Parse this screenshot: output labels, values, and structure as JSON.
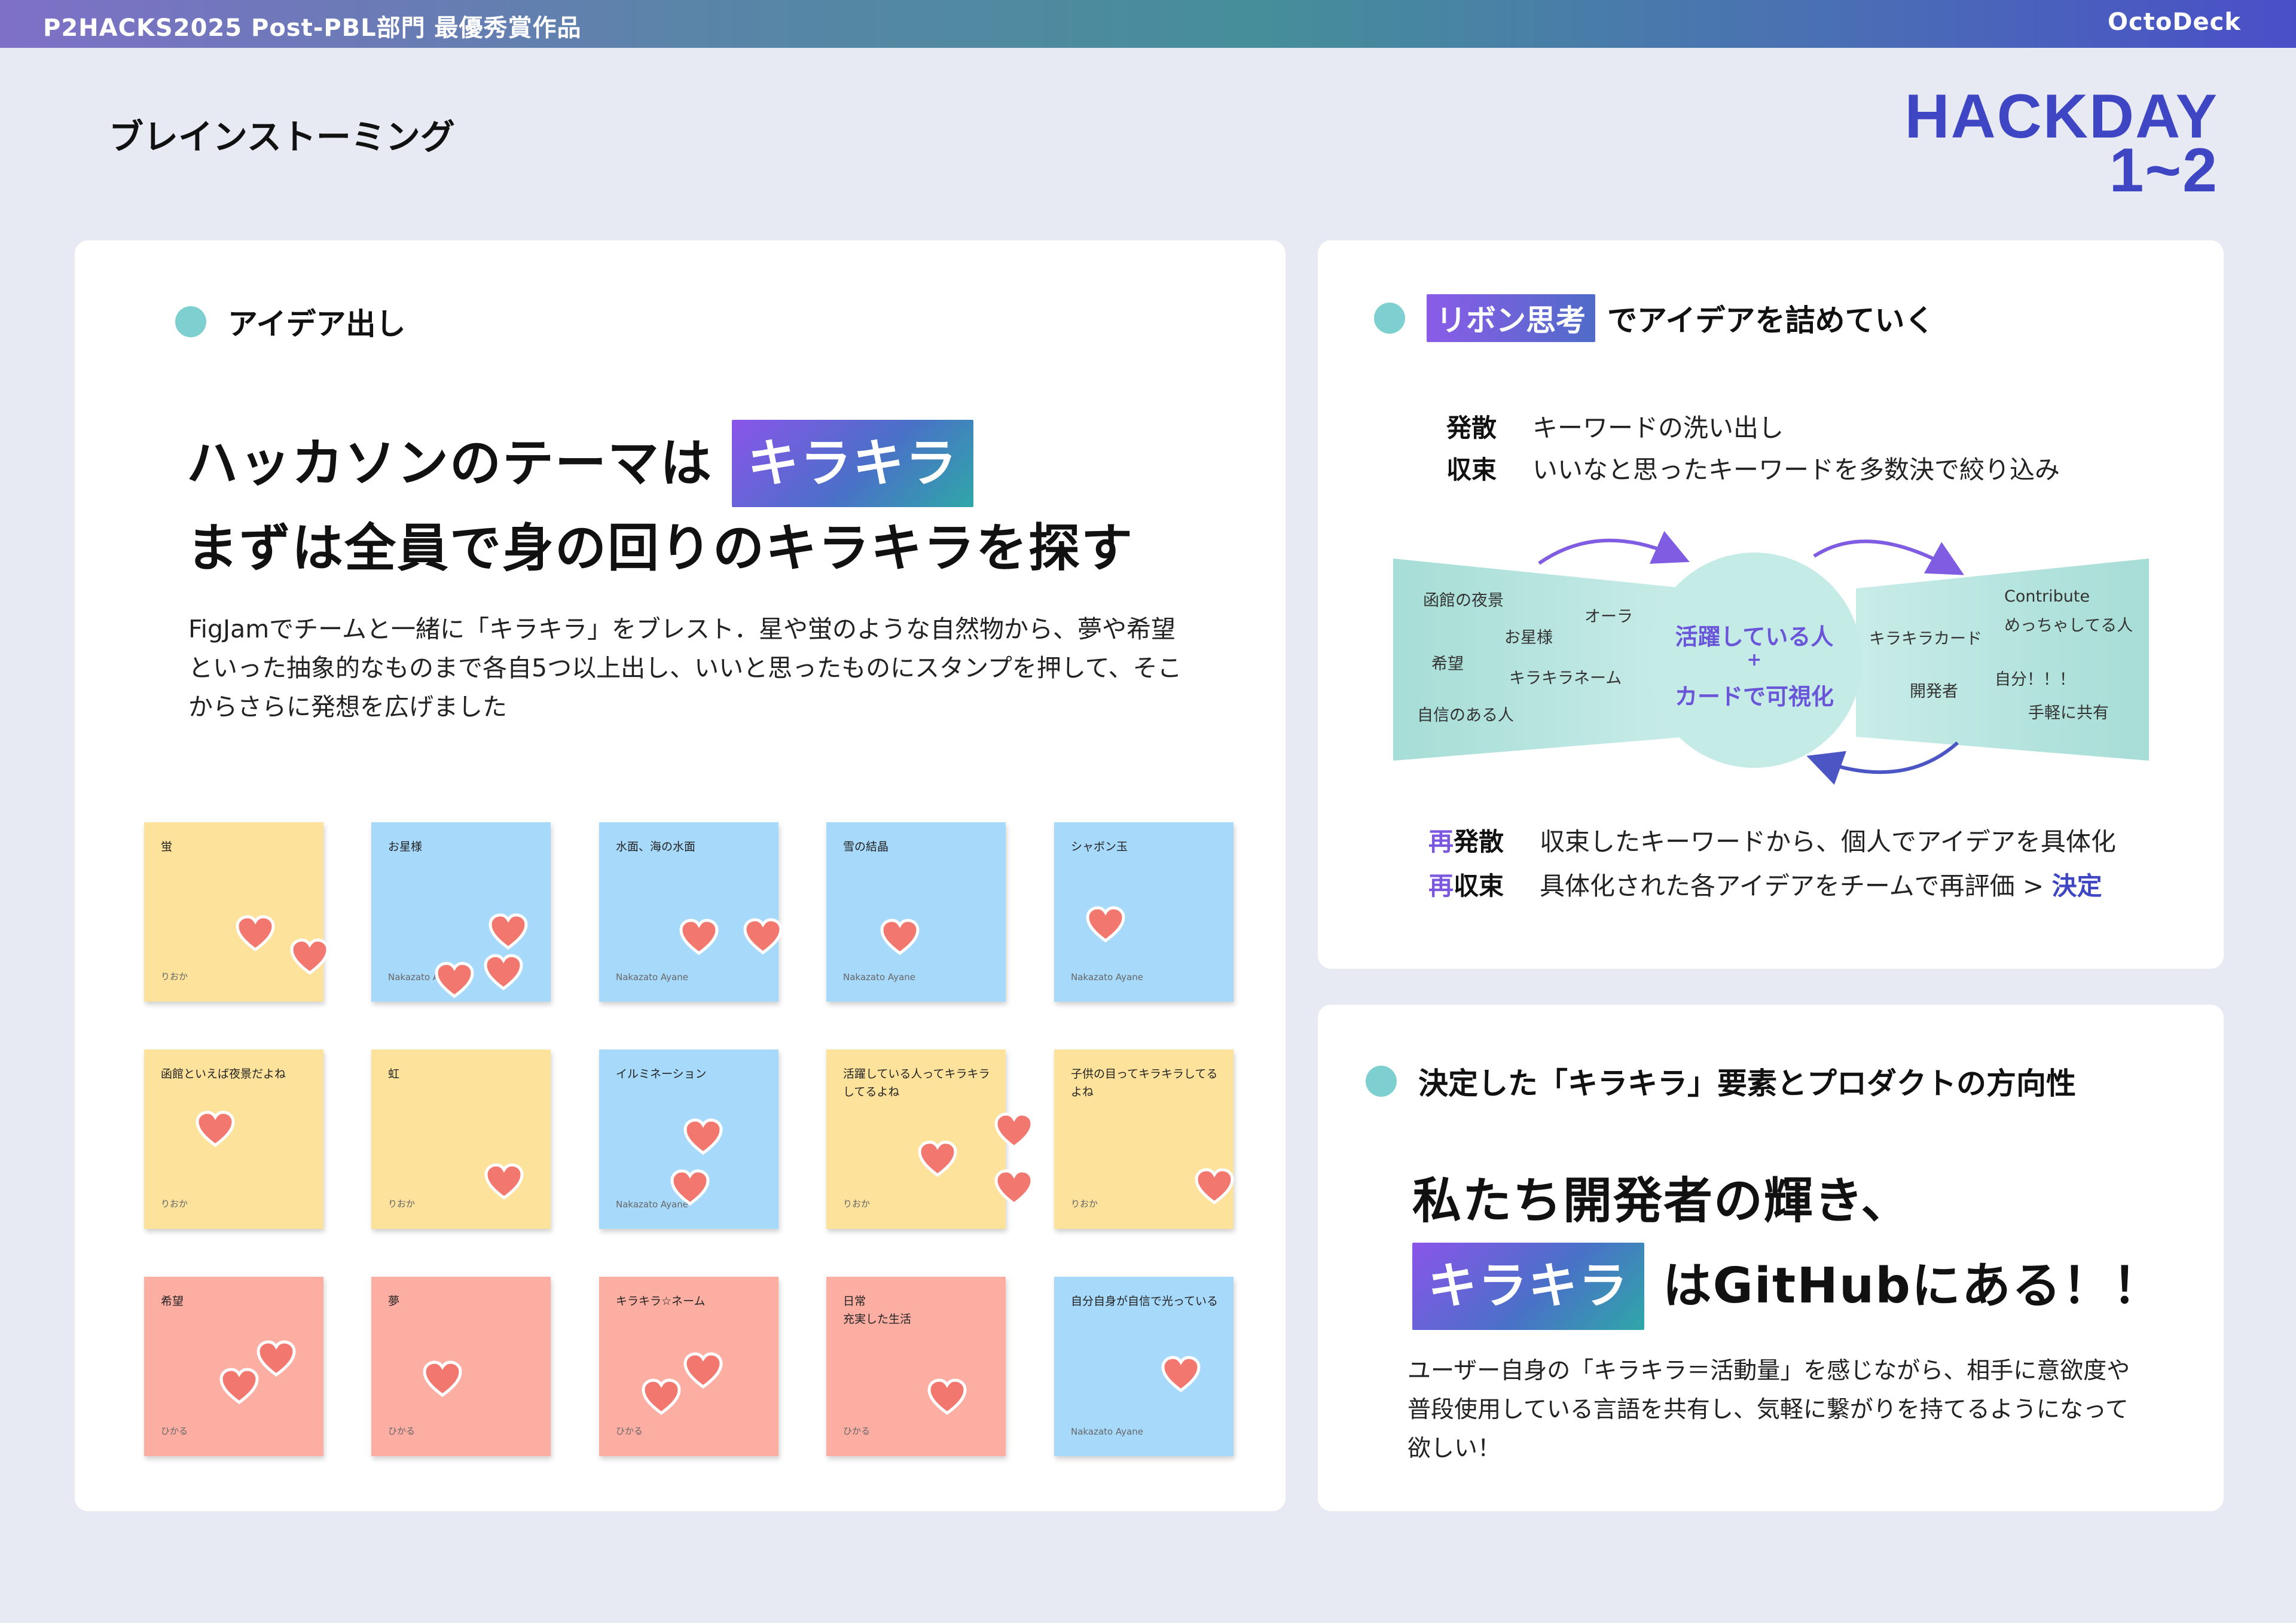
{
  "header": {
    "left": "P2HACKS2025 Post-PBL部門 最優秀賞作品",
    "right": "OctoDeck"
  },
  "page_title": "ブレインストーミング",
  "hackday": {
    "line1": "HACKDAY",
    "line2": "1~2"
  },
  "ideas": {
    "heading": "アイデア出し",
    "headline_pre": "ハッカソンのテーマは",
    "headline_badge": "キラキラ",
    "headline_line2": "まずは全員で身の回りのキラキラを探す",
    "para": [
      "FigJamでチームと一緒に「キラキラ」をブレスト．星や蛍のような自然物から、夢や希望",
      "といった抽象的なものまで各自5つ以上出し、いいと思ったものにスタンプを押して、そこ",
      "からさらに発想を広げました"
    ],
    "notes": [
      {
        "text": "蛍",
        "author": "りおか",
        "color": "y"
      },
      {
        "text": "お星様",
        "author": "Nakazato Ayane",
        "color": "b"
      },
      {
        "text": "水面、海の水面",
        "author": "Nakazato Ayane",
        "color": "b"
      },
      {
        "text": "雪の結晶",
        "author": "Nakazato Ayane",
        "color": "b"
      },
      {
        "text": "シャボン玉",
        "author": "Nakazato Ayane",
        "color": "b"
      },
      {
        "text": "函館といえば夜景だよね",
        "author": "りおか",
        "color": "y"
      },
      {
        "text": "虹",
        "author": "りおか",
        "color": "y"
      },
      {
        "text": "イルミネーション",
        "author": "Nakazato Ayane",
        "color": "b"
      },
      {
        "text": "活躍している人ってキラキラしてるよね",
        "author": "りおか",
        "color": "y"
      },
      {
        "text": "子供の目ってキラキラしてるよね",
        "author": "りおか",
        "color": "y"
      },
      {
        "text": "希望",
        "author": "ひかる",
        "color": "r"
      },
      {
        "text": "夢",
        "author": "ひかる",
        "color": "r"
      },
      {
        "text": "キラキラ☆ネーム",
        "author": "ひかる",
        "color": "r"
      },
      {
        "text": "日常\n充実した生活",
        "author": "ひかる",
        "color": "r"
      },
      {
        "text": "自分自身が自信で光っている",
        "author": "Nakazato Ayane",
        "color": "b"
      }
    ]
  },
  "ribbon": {
    "badge": "リボン思考",
    "heading": "でアイデアを詰めていく",
    "diverge": {
      "k": "発散",
      "v": "キーワードの洗い出し"
    },
    "converge": {
      "k": "収束",
      "v": "いいなと思ったキーワードを多数決で絞り込み"
    },
    "left_words": [
      "函館の夜景",
      "オーラ",
      "お星様",
      "希望",
      "キラキラネーム",
      "自信のある人"
    ],
    "right_words": [
      "Contribute",
      "めっちゃしてる人",
      "キラキラカード",
      "開発者",
      "自分！！！",
      "手軽に共有"
    ],
    "center": [
      "活躍している人",
      "+",
      "カードで可視化"
    ],
    "re_diverge": {
      "p": "再",
      "k": "発散",
      "v": "収束したキーワードから、個人でアイデアを具体化"
    },
    "re_converge": {
      "p": "再",
      "k": "収束",
      "v": "具体化された各アイデアをチームで再評価 > ",
      "accent": "決定"
    }
  },
  "decided": {
    "heading": "決定した「キラキラ」要素とプロダクトの方向性",
    "line1": "私たち開発者の輝き、",
    "badge": "キラキラ",
    "line2": "はGitHubにある！！",
    "para": [
      "ユーザー自身の「キラキラ＝活動量」を感じながら、相手に意欲度や",
      "普段使用している言語を共有し、気軽に繋がりを持てるようになって",
      "欲しい！"
    ]
  },
  "colors": {
    "accent": "#3f46c4",
    "teal": "#7ecfcf",
    "heart": "#f2776e",
    "note_yellow": "#fde29c",
    "note_blue": "#a7d9fb",
    "note_red": "#fdaea3"
  }
}
